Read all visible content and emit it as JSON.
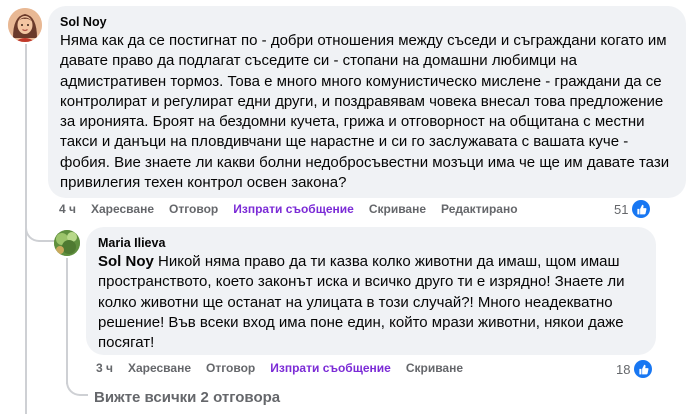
{
  "comment": {
    "author": "Sol Noy",
    "text": "Няма как да се постигнат по - добри отношения между съседи и съграждани когато им давате право да подлагат съседите си - стопани на домашни любимци на адмистративен тормоз. Това е много много комунистическо мислене - граждани да се контролират и регулират едни други, и поздравявам човека внесал това предложение за иронията. Броят на бездомни кучета, грижа и отговорност на общитана с местни такси и данъци на пловдивчани ще нарастне и си го заслужавата с вашата куче - фобия. Вие знаете ли какви болни недобросъвестни мозъци има че ще им давате тази привилегия техен контрол освен закона?",
    "time": "4 ч",
    "like_label": "Харесване",
    "reply_label": "Отговор",
    "message_label": "Изпрати съобщение",
    "hide_label": "Скриване",
    "edited_label": "Редактирано",
    "reactions": "51",
    "reaction_icon": "like-icon",
    "accent_color": "#7b2bd6"
  },
  "reply": {
    "author": "Maria Ilieva",
    "mention": "Sol Noy",
    "text": "Никой няма право да ти казва колко животни да имаш, щом имаш пространството, което законът иска и всичко друго ти е изрядно! Знаете ли колко животни ще останат на улицата в този случай?! Много неадекватно решение! Във всеки вход има поне един, който мрази животни, някои даже посягат!",
    "time": "3 ч",
    "like_label": "Харесване",
    "reply_label": "Отговор",
    "message_label": "Изпрати съобщение",
    "hide_label": "Скриване",
    "reactions": "18",
    "reaction_icon": "like-icon"
  },
  "view_all_replies": "Вижте всички 2 отговора"
}
